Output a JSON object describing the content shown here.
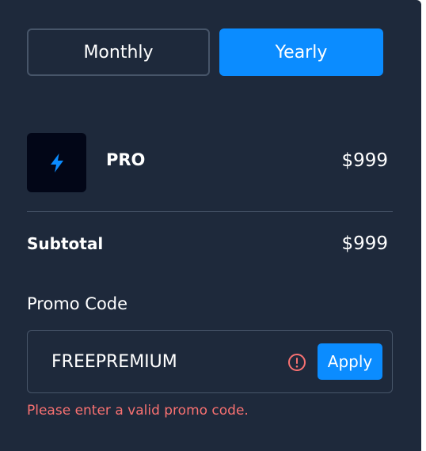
{
  "billing_toggle": {
    "monthly_label": "Monthly",
    "yearly_label": "Yearly",
    "selected": "Yearly"
  },
  "plan": {
    "icon": "lightning-bolt-icon",
    "name": "PRO",
    "price": "$999"
  },
  "summary": {
    "subtotal_label": "Subtotal",
    "subtotal_value": "$999"
  },
  "promo": {
    "label": "Promo Code",
    "value": "FREEPREMIUM",
    "apply_label": "Apply",
    "error_message": "Please enter a valid promo code.",
    "error_icon": "error-circle-icon"
  },
  "colors": {
    "panel_background": "#1e293b",
    "accent": "#0b8cff",
    "border": "#475569",
    "error": "#f87171",
    "icon_tile": "#020617"
  }
}
